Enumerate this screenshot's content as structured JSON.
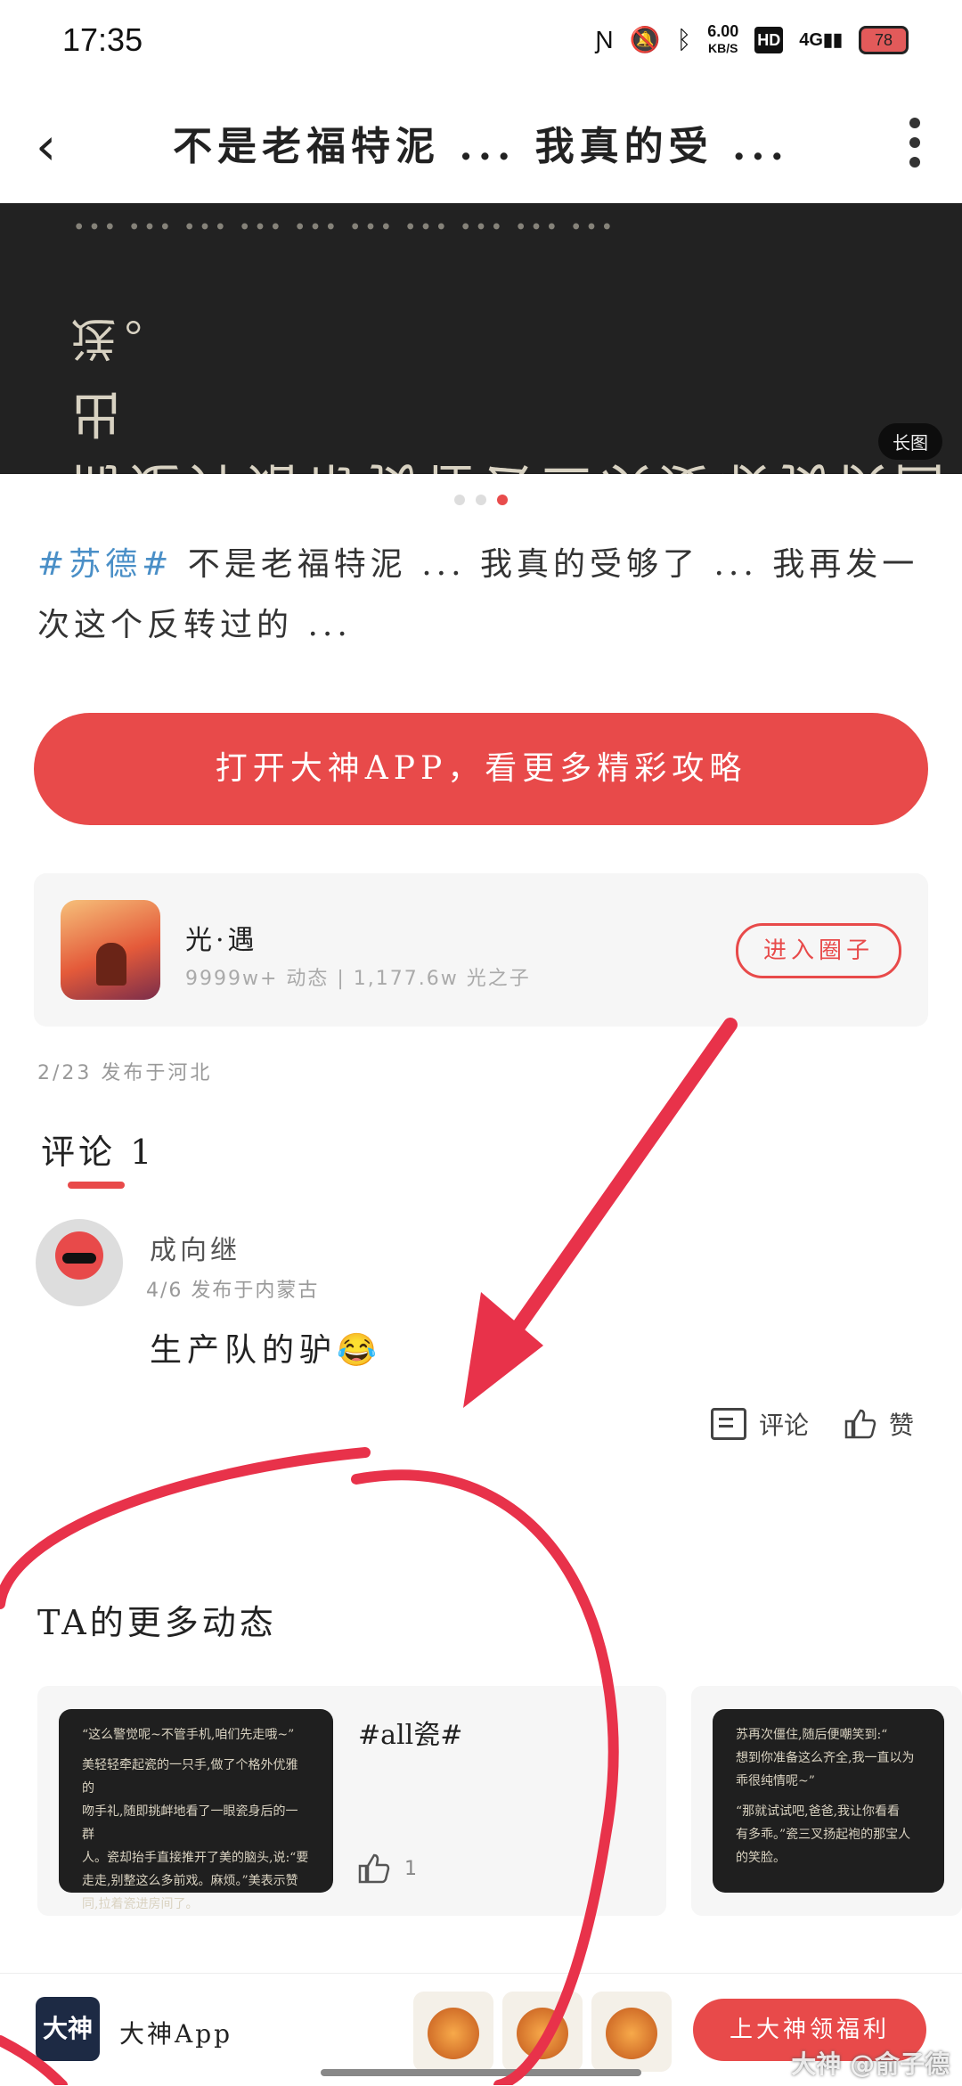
{
  "status_bar": {
    "time": "17:35",
    "net_speed": "6.00",
    "net_unit": "KB/S",
    "hd": "HD",
    "network": "4G",
    "battery": "78"
  },
  "header": {
    "title": "不是老福特泥 ... 我真的受 ...",
    "back_icon": "chevron-left-icon",
    "more_icon": "more-vertical-icon"
  },
  "banner": {
    "mirror_line_1": "…………………………",
    "mirror_line_2": "送。",
    "mirror_line_3": "而是开始帮我在去三次爱收我快回出",
    "long_image_label": "长图",
    "page_count": 3,
    "active_page": 3
  },
  "post": {
    "hashtag": "#苏德#",
    "text": " 不是老福特泥 ... 我真的受够了 ... 我再发一次这个反转过的 ..."
  },
  "open_app_button": "打开大神APP，看更多精彩攻略",
  "circle": {
    "name": "光·遇",
    "stats": "9999w+ 动态 | 1,177.6w 光之子",
    "enter_label": "进入圈子"
  },
  "publish_info": "2/23 发布于河北",
  "comments": {
    "title": "评论 1",
    "items": [
      {
        "name": "成向继",
        "meta": "4/6 发布于内蒙古",
        "text": "生产队的驴😂"
      }
    ],
    "comment_label": "评论",
    "like_label": "赞"
  },
  "more_posts": {
    "title": "TA的更多动态",
    "cards": [
      {
        "tag": "#all瓷#",
        "likes": "1",
        "thumb_lines": [
          "“这么警觉呢~不管手机,咱们先走哦~”",
          "",
          "美轻轻牵起瓷的一只手,做了个格外优雅的",
          "吻手礼,随即挑衅地看了一眼瓷身后的一群",
          "人。瓷却抬手直接推开了美的脑头,说:“要",
          "走走,别整这么多前戏。麻烦。”美表示赞",
          "同,拉着瓷进房间了。"
        ]
      },
      {
        "tag": "",
        "likes": "",
        "thumb_lines": [
          "苏再次僵住,随后便嘲笑到:“",
          "想到你准备这么齐全,我一直以为",
          "乖很纯情呢~”",
          "",
          "“那就试试吧,爸爸,我让你看看",
          "有多乖。”瓷三叉扬起袍的那宝人",
          "的笑脸。"
        ]
      }
    ]
  },
  "bottom_bar": {
    "logo_text": "大神",
    "app_name": "大神App",
    "welfare_label": "上大神领福利"
  },
  "watermark": "大神 @俞子德",
  "colors": {
    "accent": "#e84a4a",
    "tag_blue": "#4a8fc7",
    "banner_bg": "#222222"
  }
}
